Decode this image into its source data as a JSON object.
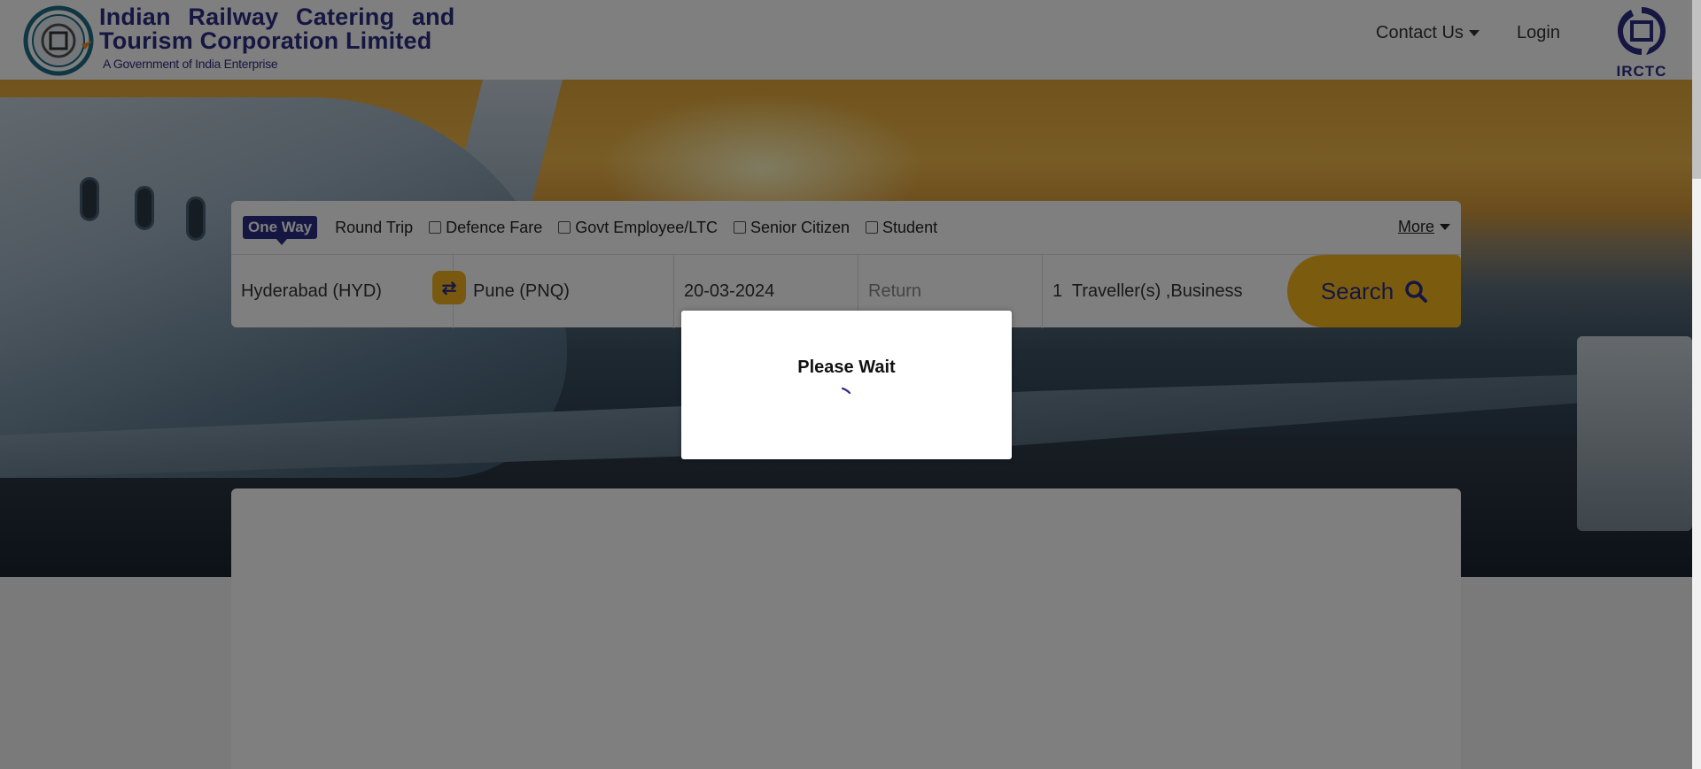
{
  "header": {
    "brand_line1": "Indian Railway Catering and",
    "brand_line2": "Tourism Corporation Limited",
    "brand_sub": "A Government of India Enterprise",
    "contact_label": "Contact Us",
    "login_label": "Login",
    "irctc_logo_text": "IRCTC"
  },
  "search": {
    "trip_types": {
      "one_way": "One Way",
      "round_trip": "Round Trip"
    },
    "fare_options": [
      {
        "label": "Defence Fare",
        "checked": false
      },
      {
        "label": "Govt Employee/LTC",
        "checked": false
      },
      {
        "label": "Senior Citizen",
        "checked": false
      },
      {
        "label": "Student",
        "checked": false
      }
    ],
    "more_label": "More",
    "from": "Hyderabad (HYD)",
    "to": "Pune (PNQ)",
    "departure_date": "20-03-2024",
    "return_placeholder": "Return",
    "travellers": "1  Traveller(s) ,Business",
    "search_label": "Search"
  },
  "modal": {
    "title": "Please Wait"
  },
  "colors": {
    "brand_navy": "#2b2d84",
    "accent_yellow": "#f7b81f"
  }
}
